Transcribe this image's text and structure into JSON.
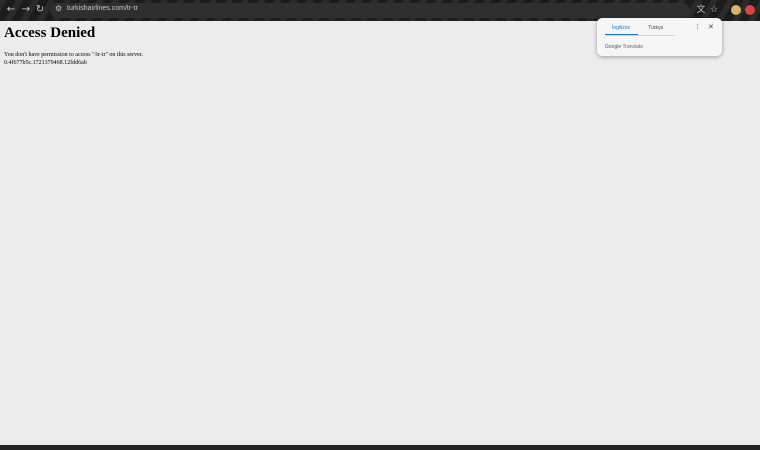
{
  "browser": {
    "back_glyph": "←",
    "forward_glyph": "→",
    "reload_glyph": "↻",
    "site_info_glyph": "⚙",
    "url": "turkishairlines.com/tr-tr",
    "translate_glyph": "文",
    "star_glyph": "☆"
  },
  "page": {
    "heading": "Access Denied",
    "message": "You don't have permission to access \"/tr-tr\" on this server.",
    "reference": "0.4f677b5c.1721379468.12fdd6ab"
  },
  "translate_popup": {
    "tabs": [
      {
        "label": "İngilizce",
        "active": true
      },
      {
        "label": "Türkçe",
        "active": false
      }
    ],
    "more_glyph": "⋮",
    "close_glyph": "✕",
    "brand": "Google",
    "product": "Translate"
  },
  "colors": {
    "page_background": "#ececec",
    "browser_bar": "#1f1f1f",
    "accent": "#1a73e8"
  }
}
